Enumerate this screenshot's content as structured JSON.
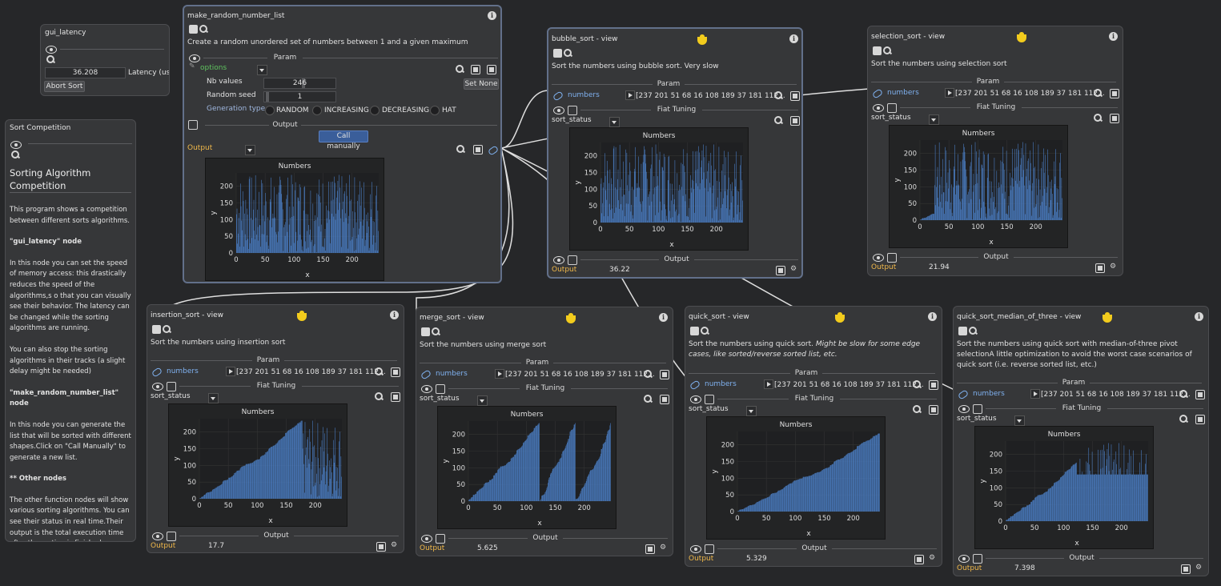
{
  "colors": {
    "background": "#262729",
    "node": "#363739",
    "link": "#7fb1ef",
    "output": "#f0b84a",
    "bars": "#4b7ec4"
  },
  "gui_latency": {
    "title": "gui_latency",
    "latency_value": "36.208",
    "latency_label": "Latency (us)",
    "abort_button": "Abort Sort"
  },
  "sort_competition": {
    "title": "Sort Competition",
    "heading": "Sorting Algorithm Competition",
    "paragraphs": [
      "This program shows a competition between different sorts algorithms.",
      "\"gui_latency\" node",
      "In this node you can set the speed of memory access: this drastically reduces the speed of the algorithms,s o that you can visually see their behavior. The latency can be changed while the sorting algorithms are running.",
      "You can also stop the sorting algorithms in their tracks (a slight delay might be needed)",
      "\"make_random_number_list\" node",
      "In this node you can generate the list that will be sorted with different shapes.Click on \"Call Manually\" to generate a new list.",
      "** Other nodes",
      "The other function nodes will show various sorting algorithms. You can see their status in real time.Their output is the total execution time after the sorting is finished."
    ]
  },
  "make_random": {
    "title": "make_random_number_list",
    "description": "Create a random unordered set of numbers between 1 and a given maximum",
    "param": "Param",
    "options": "options",
    "set_none": "Set None",
    "nb_values_label": "Nb values",
    "nb_values": "246",
    "nb_values_fraction": 0.55,
    "seed_label": "Random seed",
    "seed": "1",
    "gen_label": "Generation type",
    "gen_options": [
      "RANDOM",
      "INCREASING",
      "DECREASING",
      "HAT"
    ],
    "output_section": "Output",
    "call_manually": "Call manually",
    "output_label": "Output"
  },
  "common": {
    "param": "Param",
    "numbers": "numbers",
    "numbers_value": "[237 201  51  68  16 108 189  37 181 112...",
    "fiat_tuning": "Fiat Tuning",
    "sort_status": "sort_status",
    "output_section": "Output",
    "output_label": "Output"
  },
  "nodes": [
    {
      "key": "bubble",
      "title": "bubble_sort - view",
      "description": "Sort the numbers using bubble sort. Very slow",
      "output_value": "36.22"
    },
    {
      "key": "selection",
      "title": "selection_sort - view",
      "description": "Sort the numbers using selection sort",
      "output_value": "21.94"
    },
    {
      "key": "insertion",
      "title": "insertion_sort - view",
      "description": "Sort the numbers using insertion sort",
      "output_value": "17.7"
    },
    {
      "key": "merge",
      "title": "merge_sort - view",
      "description": "Sort the numbers using merge sort",
      "output_value": "5.625"
    },
    {
      "key": "quick",
      "title": "quick_sort - view",
      "description": "Sort the numbers using quick sort.",
      "description_italic": "Might be slow for some edge cases, like sorted/reverse sorted list, etc.",
      "output_value": "5.329"
    },
    {
      "key": "median",
      "title": "quick_sort_median_of_three - view",
      "description": "Sort the numbers using quick sort with median-of-three pivot selectionA little optimization to avoid the worst case scenarios of quick sort (i.e. reverse sorted list, etc.)",
      "output_value": "7.398"
    }
  ],
  "chart_data": [
    {
      "id": "random",
      "type": "bar",
      "title": "Numbers",
      "xlabel": "x",
      "ylabel": "y",
      "xlim": [
        0,
        246
      ],
      "ylim": [
        0,
        240
      ],
      "xticks": [
        0,
        50,
        100,
        150,
        200
      ],
      "yticks": [
        0,
        50,
        100,
        150,
        200
      ],
      "shape": "random"
    },
    {
      "id": "bubble",
      "type": "bar",
      "title": "Numbers",
      "xlabel": "x",
      "ylabel": "y",
      "xlim": [
        0,
        246
      ],
      "ylim": [
        0,
        240
      ],
      "xticks": [
        0,
        50,
        100,
        150,
        200
      ],
      "yticks": [
        0,
        50,
        100,
        150,
        200
      ],
      "shape": "bubble"
    },
    {
      "id": "selection",
      "type": "bar",
      "title": "Numbers",
      "xlabel": "x",
      "ylabel": "y",
      "xlim": [
        0,
        246
      ],
      "ylim": [
        0,
        240
      ],
      "xticks": [
        0,
        50,
        100,
        150,
        200
      ],
      "yticks": [
        0,
        50,
        100,
        150,
        200
      ],
      "shape": "selection"
    },
    {
      "id": "insertion",
      "type": "bar",
      "title": "Numbers",
      "xlabel": "x",
      "ylabel": "y",
      "xlim": [
        0,
        246
      ],
      "ylim": [
        0,
        240
      ],
      "xticks": [
        0,
        50,
        100,
        150,
        200
      ],
      "yticks": [
        0,
        50,
        100,
        150,
        200
      ],
      "shape": "insertion"
    },
    {
      "id": "merge",
      "type": "bar",
      "title": "Numbers",
      "xlabel": "x",
      "ylabel": "y",
      "xlim": [
        0,
        246
      ],
      "ylim": [
        0,
        240
      ],
      "xticks": [
        0,
        50,
        100,
        150,
        200
      ],
      "yticks": [
        0,
        50,
        100,
        150,
        200
      ],
      "shape": "merge"
    },
    {
      "id": "quick",
      "type": "bar",
      "title": "Numbers",
      "xlabel": "x",
      "ylabel": "y",
      "xlim": [
        0,
        246
      ],
      "ylim": [
        0,
        240
      ],
      "xticks": [
        0,
        50,
        100,
        150,
        200
      ],
      "yticks": [
        0,
        50,
        100,
        150,
        200
      ],
      "shape": "sorted"
    },
    {
      "id": "median",
      "type": "bar",
      "title": "Numbers",
      "xlabel": "x",
      "ylabel": "y",
      "xlim": [
        0,
        246
      ],
      "ylim": [
        0,
        240
      ],
      "xticks": [
        0,
        50,
        100,
        150,
        200
      ],
      "yticks": [
        0,
        50,
        100,
        150,
        200
      ],
      "shape": "median"
    }
  ]
}
